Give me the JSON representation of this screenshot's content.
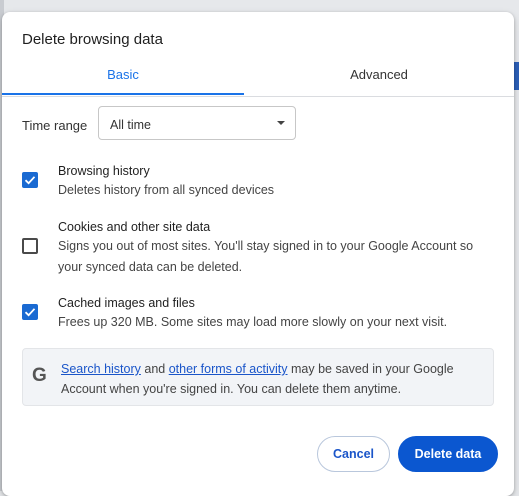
{
  "dialog": {
    "title": "Delete browsing data",
    "tabs": [
      {
        "label": "Basic",
        "selected": true
      },
      {
        "label": "Advanced",
        "selected": false
      }
    ],
    "time_range": {
      "label": "Time range",
      "value": "All time"
    },
    "options": [
      {
        "title": "Browsing history",
        "description": "Deletes history from all synced devices",
        "checked": true
      },
      {
        "title": "Cookies and other site data",
        "description": "Signs you out of most sites. You'll stay signed in to your Google Account so your synced data can be deleted.",
        "checked": false
      },
      {
        "title": "Cached images and files",
        "description": "Frees up 320 MB. Some sites may load more slowly on your next visit.",
        "checked": true
      }
    ],
    "info": {
      "icon": "google-g-icon",
      "link1": "Search history",
      "and": " and ",
      "link2": "other forms of activity",
      "rest": " may be saved in your Google Account when you're signed in. You can delete them anytime."
    },
    "buttons": {
      "cancel": "Cancel",
      "delete": "Delete data"
    },
    "colors": {
      "accent": "#1a73e8",
      "primary_button": "#0b57d0"
    }
  }
}
